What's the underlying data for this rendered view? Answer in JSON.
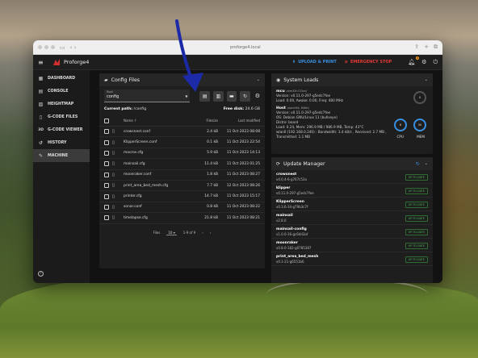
{
  "browser": {
    "url": "proforge4.local"
  },
  "app": {
    "name": "Proforge4",
    "upload_label": "UPLOAD & PRINT",
    "estop_label": "EMERGENCY STOP",
    "notif_count": "4"
  },
  "sidebar": {
    "items": [
      {
        "label": "DASHBOARD",
        "icon": "dashboard-icon"
      },
      {
        "label": "CONSOLE",
        "icon": "console-icon"
      },
      {
        "label": "HEIGHTMAP",
        "icon": "heightmap-icon"
      },
      {
        "label": "G-CODE FILES",
        "icon": "file-icon"
      },
      {
        "label": "G-CODE VIEWER",
        "icon": "3d-icon"
      },
      {
        "label": "HISTORY",
        "icon": "history-icon"
      },
      {
        "label": "MACHINE",
        "icon": "wrench-icon"
      }
    ]
  },
  "config": {
    "title": "Config Files",
    "root_label": "Root",
    "root_value": "config",
    "current_path_label": "Current path:",
    "current_path": "/config",
    "free_disk_label": "Free disk:",
    "free_disk": "24.6 GB",
    "headers": {
      "name": "Name",
      "size": "Filesize",
      "date": "Last modified"
    },
    "files": [
      {
        "name": "crowsnest.conf",
        "size": "2.4 kB",
        "date": "11 Oct 2023 08:08"
      },
      {
        "name": "KlipperScreen.conf",
        "size": "0.1 kB",
        "date": "11 Oct 2023 22:54"
      },
      {
        "name": "macros.cfg",
        "size": "5.9 kB",
        "date": "11 Oct 2023 14:13"
      },
      {
        "name": "mainsail.cfg",
        "size": "11.4 kB",
        "date": "11 Oct 2023 01:25"
      },
      {
        "name": "moonraker.conf",
        "size": "1.8 kB",
        "date": "11 Oct 2023 08:27"
      },
      {
        "name": "print_area_bed_mesh.cfg",
        "size": "7.7 kB",
        "date": "12 Oct 2023 08:26"
      },
      {
        "name": "printer.cfg",
        "size": "14.7 kB",
        "date": "11 Oct 2023 15:17"
      },
      {
        "name": "sonar.conf",
        "size": "0.8 kB",
        "date": "11 Oct 2023 08:22"
      },
      {
        "name": "timelapse.cfg",
        "size": "21.8 kB",
        "date": "11 Oct 2023 08:21"
      }
    ],
    "footer": {
      "files_label": "Files",
      "per_page": "10",
      "range": "1-9 of 9"
    }
  },
  "loads": {
    "title": "System Loads",
    "mcu": {
      "name": "mcu",
      "chip": "(stm32h723xx)",
      "version": "Version: v0.11.0-297-g5edc7fee",
      "load": "Load: 0.00, Awake: 0.00, Freq: 480 MHz"
    },
    "host": {
      "name": "Host",
      "chip": "(aarch64, 64bit)",
      "lines": [
        "Version: v0.11.0-297-g5edc7fee",
        "OS: Debian GNU/Linux 11 (bullseye)",
        "Distro: board",
        "Load: 0.24, Mem: 296.9 MB / 986.9 MB, Temp: 43°C",
        "wlan0 (192.168.0.240) : Bandwidth: 3.4 kB/s , Received: 2.7 MB ,",
        "Transmitted: 1.1 MB"
      ]
    },
    "gauges": {
      "mcu": "0",
      "cpu": "6",
      "mem": "30",
      "cpu_label": "CPU",
      "mem_label": "MEM"
    }
  },
  "updates": {
    "title": "Update Manager",
    "status_label": "UP-TO-DATE",
    "items": [
      {
        "name": "crowsnest",
        "version": "v4.0.4-6-g767c53a"
      },
      {
        "name": "klipper",
        "version": "v0.11.0-297-g5edc7fee"
      },
      {
        "name": "KlipperScreen",
        "version": "v0.3.6-34-g79b3c7f"
      },
      {
        "name": "mainsail",
        "version": "v2.8.0"
      },
      {
        "name": "mainsail-config",
        "version": "v1.0.0-16-gc64d3af"
      },
      {
        "name": "moonraker",
        "version": "v0.8.0-182-g0785387"
      },
      {
        "name": "print_area_bed_mesh",
        "version": "v0.1-21-g6551b6"
      }
    ]
  }
}
